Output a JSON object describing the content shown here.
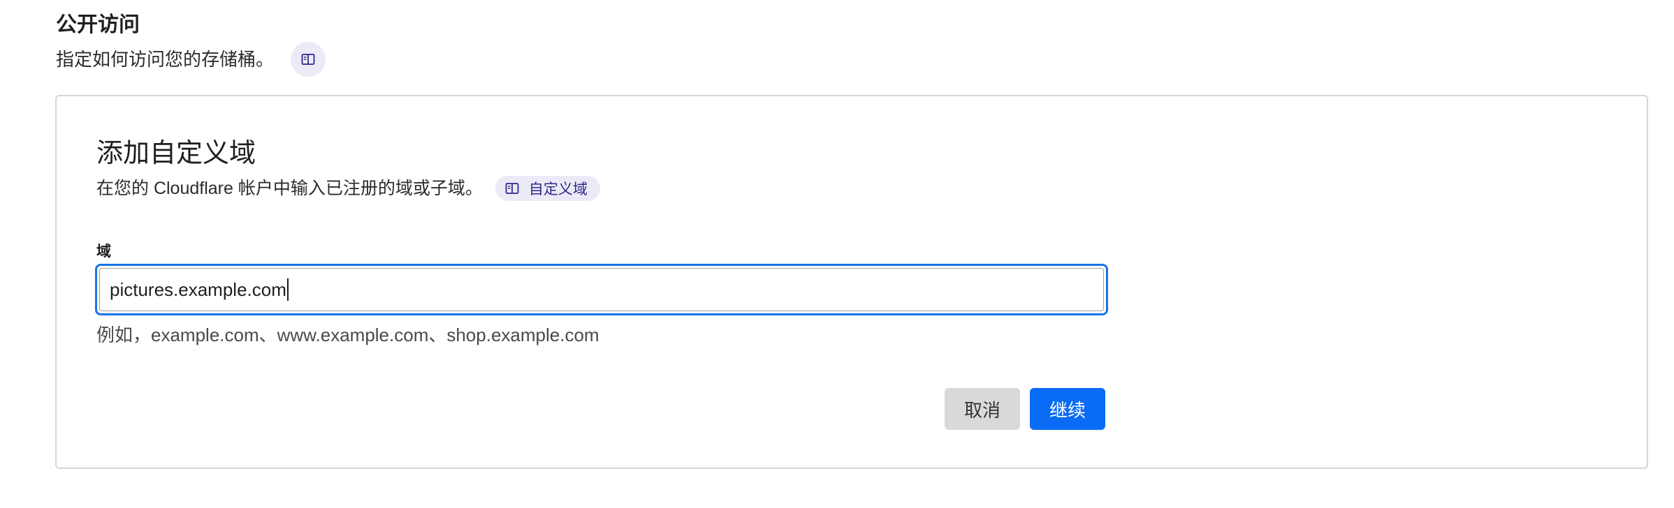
{
  "section": {
    "title": "公开访问",
    "description": "指定如何访问您的存储桶。"
  },
  "card": {
    "title": "添加自定义域",
    "description": "在您的 Cloudflare 帐户中输入已注册的域或子域。",
    "doc_link_label": "自定义域",
    "field": {
      "label": "域",
      "value": "pictures.example.com",
      "hint": "例如，example.com、www.example.com、shop.example.com"
    },
    "buttons": {
      "cancel": "取消",
      "continue": "继续"
    }
  },
  "icons": {
    "docs": "book-icon"
  },
  "colors": {
    "accent": "#0a6cf5",
    "focus_ring": "#1a73e8",
    "doc_badge_bg": "#eceaf7",
    "doc_badge_text": "#2d2a8a",
    "cancel_bg": "#d9d9d9"
  }
}
